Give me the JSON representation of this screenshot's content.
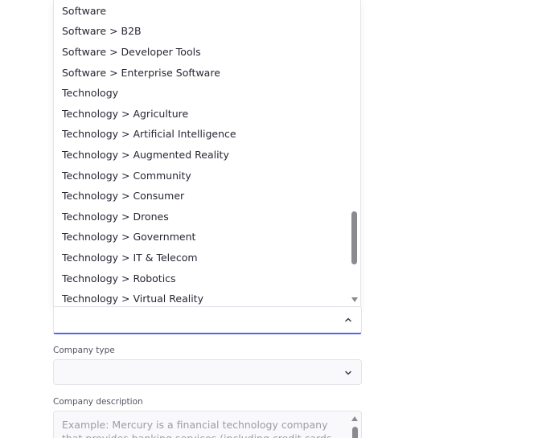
{
  "industry_dropdown": {
    "options": [
      "Software",
      "Software > B2B",
      "Software > Developer Tools",
      "Software > Enterprise Software",
      "Technology",
      "Technology > Agriculture",
      "Technology > Artificial Intelligence",
      "Technology > Augmented Reality",
      "Technology > Community",
      "Technology > Consumer",
      "Technology > Drones",
      "Technology > Government",
      "Technology > IT & Telecom",
      "Technology > Robotics",
      "Technology > Virtual Reality"
    ],
    "selected_value": "",
    "state": "expanded"
  },
  "company_type": {
    "label": "Company type",
    "selected_value": ""
  },
  "company_description": {
    "label": "Company description",
    "placeholder": "Example: Mercury is a financial technology company that provides banking services (including credit cards, etc.) to"
  },
  "icons": {
    "dropdown_open": "chevron-up-icon",
    "dropdown_closed": "chevron-down-icon",
    "scroll_down": "triangle-down-icon",
    "scroll_up": "triangle-up-icon"
  },
  "colors": {
    "focus_underline": "#5266eb",
    "option_text": "#272735",
    "label_text": "#535461",
    "placeholder_text": "#9c9ca6",
    "field_background": "#f9f9fb",
    "border": "#e3e4ea"
  }
}
